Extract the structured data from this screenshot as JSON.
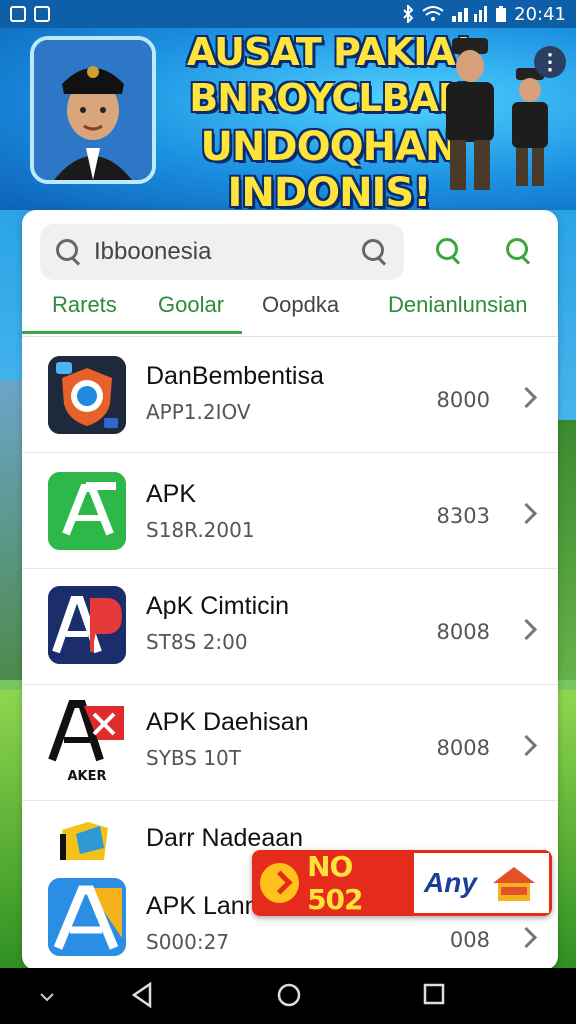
{
  "status_bar": {
    "time": "20:41"
  },
  "banner": {
    "title_line1": "AUSAT PAKIA!",
    "title_line2": "BNROYCLBAN",
    "title_line3": "UNDOQHAN INDONIS!"
  },
  "search": {
    "value": "Ibboonesia"
  },
  "tabs": [
    "Rarets",
    "Goolar",
    "Oopdka",
    "Denianlunsian"
  ],
  "apps": [
    {
      "name": "DanBembentisa",
      "sub": "APP1.2IOV",
      "count": "8000"
    },
    {
      "name": "APK",
      "sub": "S18R.2001",
      "count": "8303"
    },
    {
      "name": "ApK Cimticin",
      "sub": "ST8S 2:00",
      "count": "8008"
    },
    {
      "name": "APK Daehisan",
      "sub": "SYBS 10T",
      "count": "8008",
      "icon_caption": "AKER"
    },
    {
      "name": "Darr Nadeaan",
      "sub": "",
      "count": ""
    },
    {
      "name": "APK Lann",
      "sub": "S000:27",
      "count": "008"
    }
  ],
  "promo": {
    "left_text": "NO 502",
    "right_text": "Any"
  },
  "colors": {
    "accent_green": "#39a845",
    "status_bar": "#0f5ea8",
    "promo_red": "#e52b1b"
  }
}
